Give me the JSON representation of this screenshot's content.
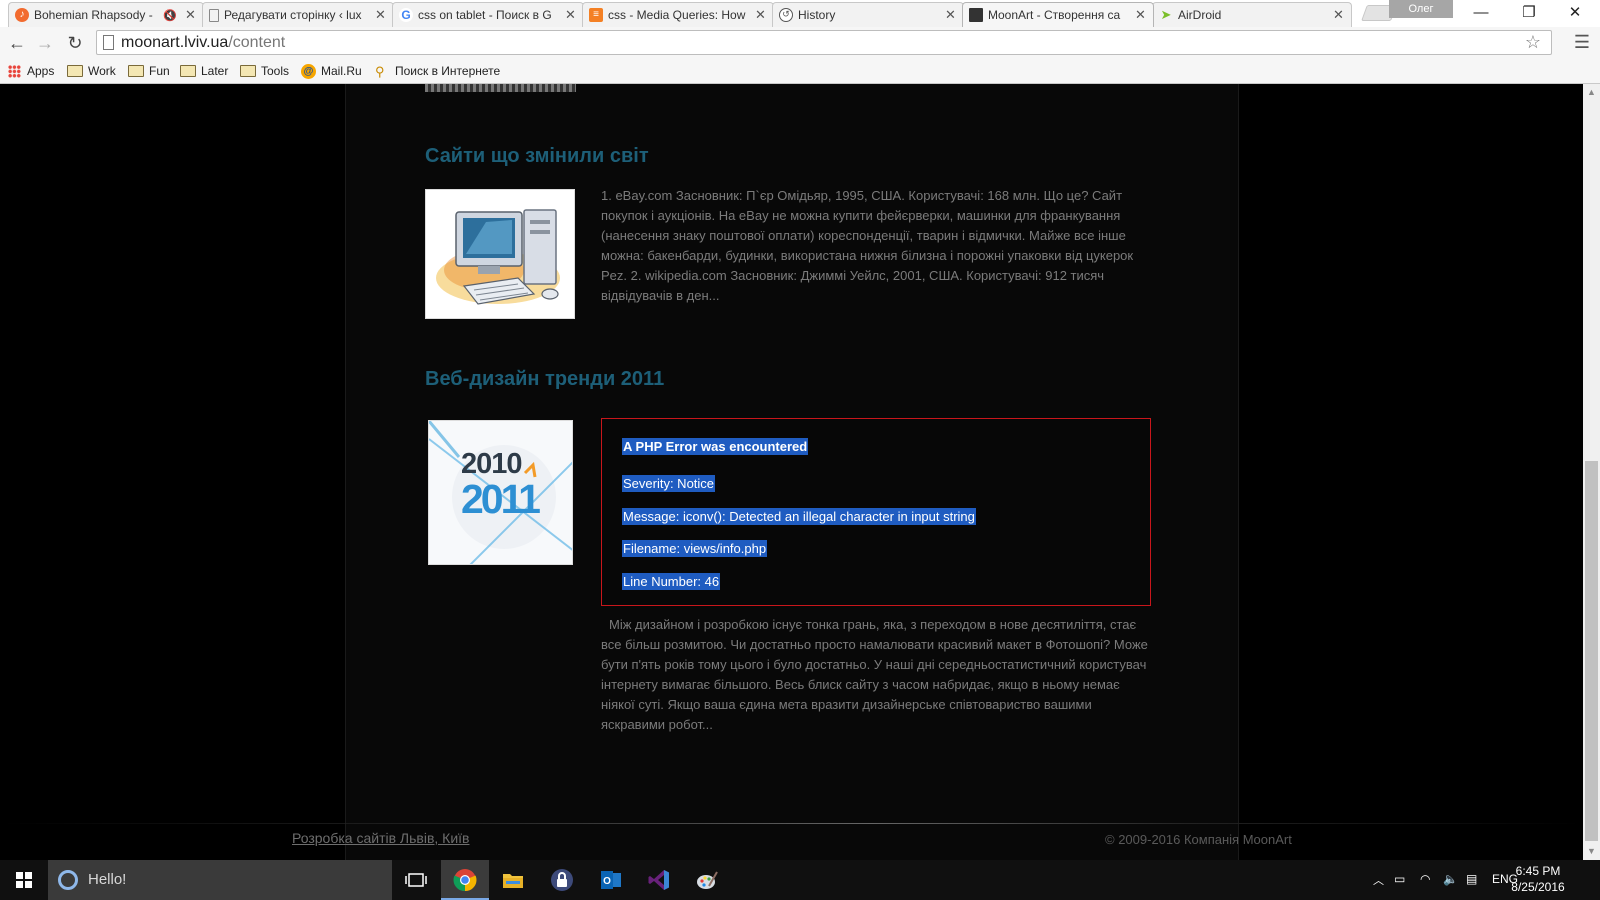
{
  "browser": {
    "tabs": [
      {
        "title": "Bohemian Rhapsody -",
        "icon": "music-icon",
        "muted": true
      },
      {
        "title": "Редагувати сторінку ‹ lux",
        "icon": "page-icon"
      },
      {
        "title": "css on tablet - Поиск в G",
        "icon": "google-icon"
      },
      {
        "title": "css - Media Queries: How",
        "icon": "stackoverflow-icon"
      },
      {
        "title": "History",
        "icon": "history-icon"
      },
      {
        "title": "MoonArt - Створення са",
        "icon": "moonart-icon",
        "active": true
      },
      {
        "title": "AirDroid",
        "icon": "airdroid-icon"
      }
    ],
    "profile_name": "Олег",
    "url_host": "moonart.lviv.ua",
    "url_path": "/content",
    "bookmarks": [
      "Apps",
      "Work",
      "Fun",
      "Later",
      "Tools",
      "Mail.Ru",
      "Поиск в Интернете"
    ]
  },
  "page": {
    "articles": [
      {
        "title": "Сайти що змінили світ",
        "excerpt": "1. eBay.com Засновник: П`єр Омідьяр, 1995, США. Користувачі: 168 млн. Що це? Сайт покупок і аукціонів. На eBay не можна купити фейєрверки, машинки для франкування (нанесення знаку поштової оплати) кореспонденції, тварин і відмички. Майже все інше можна: бакенбарди, будинки, використана нижня білизна і порожні упаковки від цукерок Pez. 2. wikipedia.com Засновник: Джиммі Уейлс, 2001, США. Користувачі: 912 тисяч відвідувачів в ден..."
      },
      {
        "title": "Веб-дизайн тренди 2011",
        "thumb_text_top": "2010",
        "thumb_text_bottom": "2011",
        "excerpt": "Між дизайном і розробкою існує тонка грань, яка, з переходом в нове десятиліття, стає все більш розмитою. Чи достатньо просто намалювати красивий макет в Фотошопі? Може бути п'ять років тому цього і було достатньо. У наші дні середньостатистичний користувач інтернету вимагає більшого. Весь блиск сайту з часом набридає, якщо в ньому немає ніякої суті. Якщо ваша єдина мета вразити дизайнерське співтовариство вашими яскравими робот..."
      }
    ],
    "php_error": {
      "heading": "A PHP Error was encountered",
      "severity": "Severity: Notice",
      "message": "Message: iconv(): Detected an illegal character in input string",
      "filename": "Filename: views/info.php",
      "line": "Line Number: 46"
    },
    "footer_link": "Розробка сайтів Львів, Київ",
    "footer_copy": "© 2009-2016 Компанія MoonArt"
  },
  "taskbar": {
    "search_text": "Hello!",
    "language": "ENG",
    "time": "6:45 PM",
    "date": "8/25/2016",
    "accent": "#7aa9e6"
  }
}
